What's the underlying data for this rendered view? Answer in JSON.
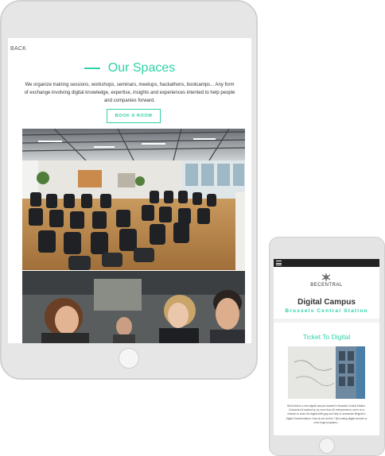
{
  "tablet": {
    "back_label": "BACK",
    "title": "Our Spaces",
    "intro": "We organize training sessions, workshops, seminars, meetups, hackathons, bootcamps... Any form of exchange involving digital knowledge, expertise, insights and experiences intented to help people and companies forward.",
    "book_button": "BOOK A ROOM"
  },
  "phone": {
    "logo_text": "BECENTRAL",
    "campus_title": "Digital Campus",
    "campus_subtitle": "Brussels Central Station",
    "ticket_title": "Ticket To Digital",
    "ticket_text": "BeCentral is a new digital campus located in Brussels Central Station. Cofounded & backed up by more than 40 entrepreneurs, we're on a mission to close the digital skills gap and help to accelerate Belgium's Digital Transformation. How do we do this ? By hosting digital schools or even large programs..."
  },
  "colors": {
    "accent": "#2fd1a6",
    "device_body": "#e6e6e6",
    "phone_nav": "#222222"
  },
  "icons": {
    "menu": "hamburger-menu-icon",
    "logo": "becentral-logo-icon"
  }
}
